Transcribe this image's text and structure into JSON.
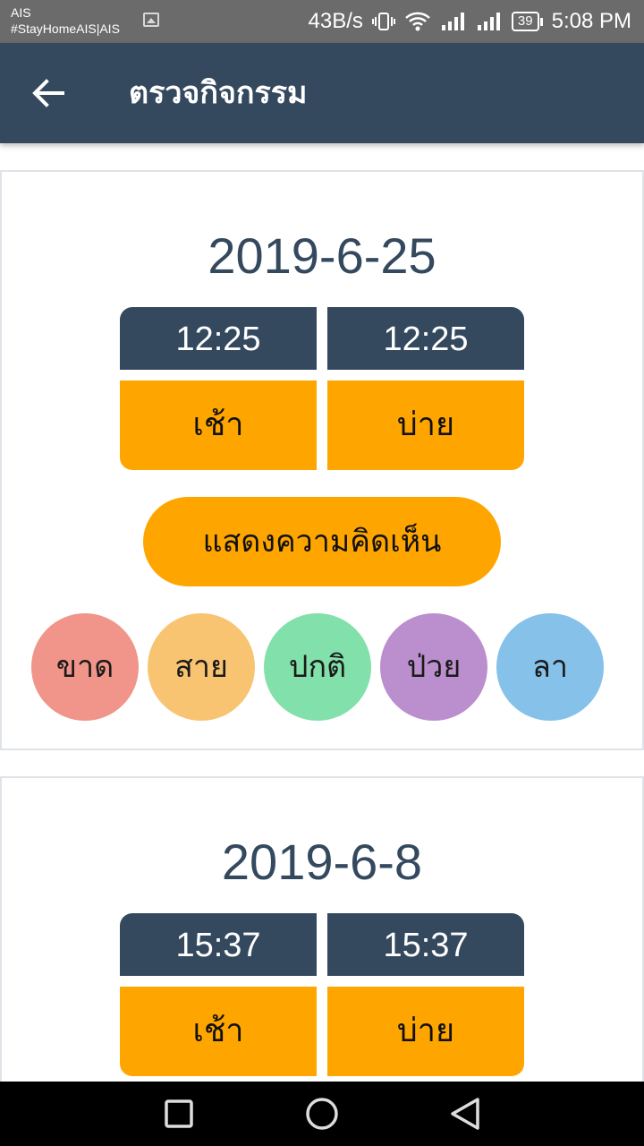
{
  "status_bar": {
    "carrier_line1": "AIS",
    "carrier_line2": "#StayHomeAIS|AIS",
    "net_speed": "43B/s",
    "battery": "39",
    "time": "5:08 PM"
  },
  "app_bar": {
    "title": "ตรวจกิจกรรม",
    "back_icon": "arrow-left-icon"
  },
  "colors": {
    "primary": "#34495e",
    "accent": "#ffa500",
    "absent": "#f1948a",
    "late": "#f8c471",
    "normal": "#82e0aa",
    "sick": "#bb8fce",
    "leave": "#85c1e9"
  },
  "entries": [
    {
      "date": "2019-6-25",
      "morning_time": "12:25",
      "afternoon_time": "12:25",
      "morning_label": "เช้า",
      "afternoon_label": "บ่าย",
      "comment_label": "แสดงความคิดเห็น",
      "statuses": [
        "ขาด",
        "สาย",
        "ปกติ",
        "ป่วย",
        "ลา"
      ]
    },
    {
      "date": "2019-6-8",
      "morning_time": "15:37",
      "afternoon_time": "15:37",
      "morning_label": "เช้า",
      "afternoon_label": "บ่าย"
    }
  ],
  "nav_bar": {
    "icons": [
      "square-recent-icon",
      "circle-home-icon",
      "triangle-back-icon"
    ]
  }
}
